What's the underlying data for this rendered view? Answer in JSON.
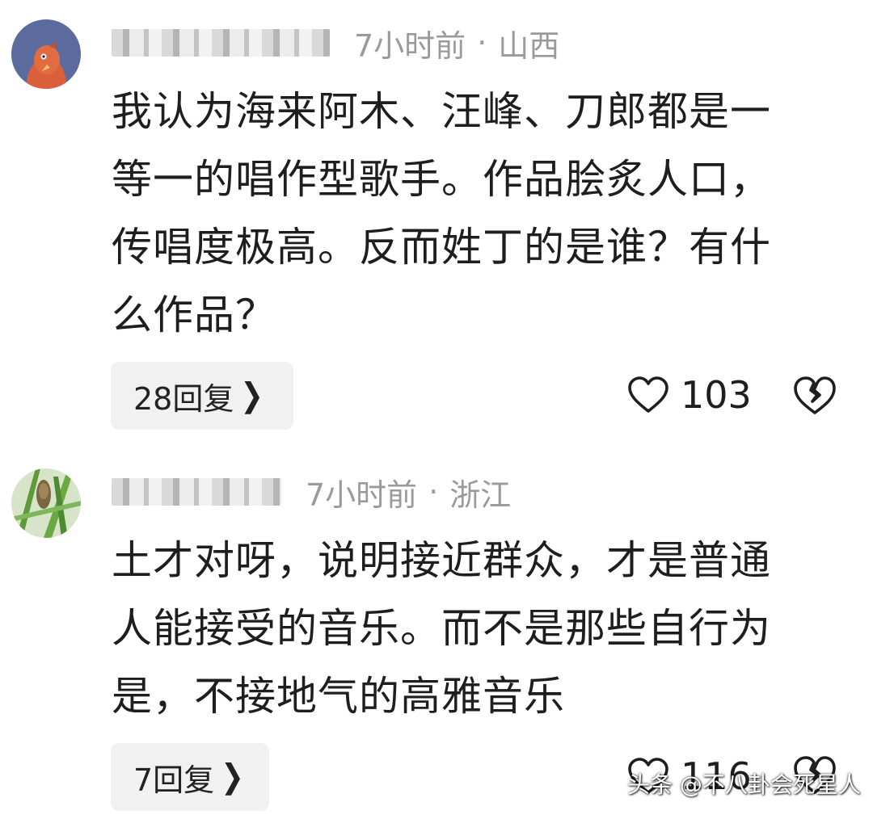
{
  "comments": [
    {
      "time": "7小时前",
      "separator": "·",
      "location": "山西",
      "lines": [
        "我认为海来阿木、汪峰、刀郎都是一",
        "等一的唱作型歌手。作品脍炙人口，",
        "传唱度极高。反而姓丁的是谁？有什",
        "么作品？"
      ],
      "reply_label": "28回复",
      "likes": "103"
    },
    {
      "time": "7小时前",
      "separator": "·",
      "location": "浙江",
      "lines": [
        "土才对呀，说明接近群众，才是普通",
        "人能接受的音乐。而不是那些自行为",
        "是，不接地气的高雅音乐"
      ],
      "reply_label": "7回复",
      "likes": "116"
    }
  ],
  "watermark": "头条 @不八卦会死星人",
  "icons": {
    "like": "heart-outline-icon",
    "dislike": "broken-heart-icon",
    "reply_chevron": "chevron-right-icon"
  },
  "colors": {
    "meta_text": "#9a9a9a",
    "body_text": "#1e1e1e",
    "reply_pill_bg": "#f1f1f1"
  }
}
